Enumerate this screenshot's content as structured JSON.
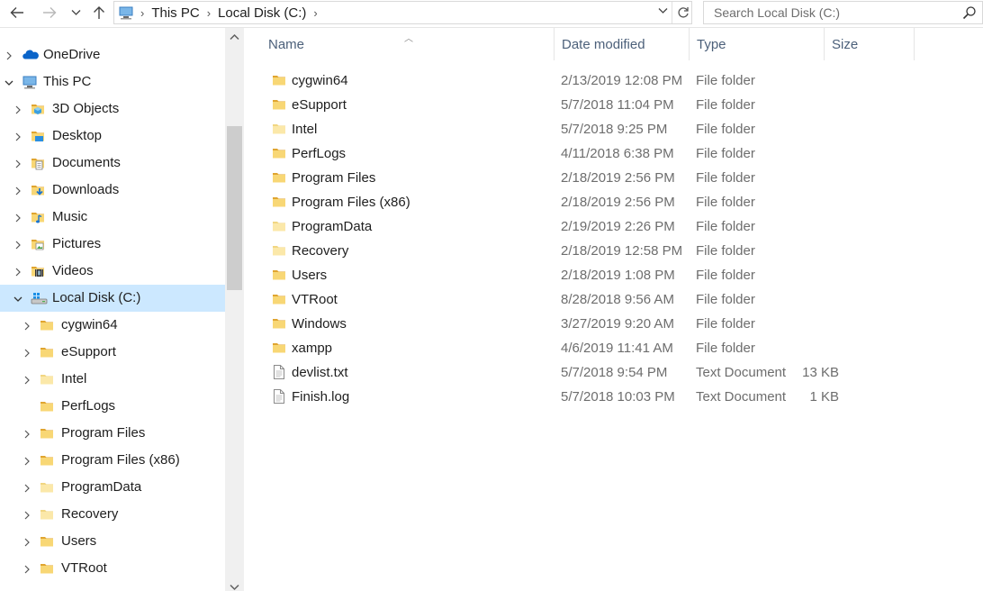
{
  "address": {
    "breadcrumbs": [
      "This PC",
      "Local Disk (C:)"
    ],
    "search_placeholder": "Search Local Disk (C:)"
  },
  "nav": {
    "items": [
      {
        "label": "OneDrive",
        "level": 0,
        "icon": "onedrive-icon",
        "expander": "collapsed",
        "selected": false
      },
      {
        "label": "This PC",
        "level": 0,
        "icon": "this-pc-icon",
        "expander": "expanded",
        "selected": false
      },
      {
        "label": "3D Objects",
        "level": 1,
        "icon": "3d-objects-icon",
        "expander": "collapsed",
        "selected": false
      },
      {
        "label": "Desktop",
        "level": 1,
        "icon": "desktop-icon",
        "expander": "collapsed",
        "selected": false
      },
      {
        "label": "Documents",
        "level": 1,
        "icon": "documents-icon",
        "expander": "collapsed",
        "selected": false
      },
      {
        "label": "Downloads",
        "level": 1,
        "icon": "downloads-icon",
        "expander": "collapsed",
        "selected": false
      },
      {
        "label": "Music",
        "level": 1,
        "icon": "music-icon",
        "expander": "collapsed",
        "selected": false
      },
      {
        "label": "Pictures",
        "level": 1,
        "icon": "pictures-icon",
        "expander": "collapsed",
        "selected": false
      },
      {
        "label": "Videos",
        "level": 1,
        "icon": "videos-icon",
        "expander": "collapsed",
        "selected": false
      },
      {
        "label": "Local Disk (C:)",
        "level": 1,
        "icon": "local-disk-icon",
        "expander": "expanded",
        "selected": true
      },
      {
        "label": "cygwin64",
        "level": 2,
        "icon": "folder-icon",
        "expander": "collapsed",
        "selected": false
      },
      {
        "label": "eSupport",
        "level": 2,
        "icon": "folder-icon",
        "expander": "collapsed",
        "selected": false
      },
      {
        "label": "Intel",
        "level": 2,
        "icon": "folder-light-icon",
        "expander": "collapsed",
        "selected": false
      },
      {
        "label": "PerfLogs",
        "level": 2,
        "icon": "folder-icon",
        "expander": "none",
        "selected": false
      },
      {
        "label": "Program Files",
        "level": 2,
        "icon": "folder-icon",
        "expander": "collapsed",
        "selected": false
      },
      {
        "label": "Program Files (x86)",
        "level": 2,
        "icon": "folder-icon",
        "expander": "collapsed",
        "selected": false
      },
      {
        "label": "ProgramData",
        "level": 2,
        "icon": "folder-light-icon",
        "expander": "collapsed",
        "selected": false
      },
      {
        "label": "Recovery",
        "level": 2,
        "icon": "folder-light-icon",
        "expander": "collapsed",
        "selected": false
      },
      {
        "label": "Users",
        "level": 2,
        "icon": "folder-icon",
        "expander": "collapsed",
        "selected": false
      },
      {
        "label": "VTRoot",
        "level": 2,
        "icon": "folder-icon",
        "expander": "collapsed",
        "selected": false
      }
    ]
  },
  "columns": {
    "name": "Name",
    "date": "Date modified",
    "type": "Type",
    "size": "Size"
  },
  "files": [
    {
      "name": "cygwin64",
      "date": "2/13/2019 12:08 PM",
      "type": "File folder",
      "size": "",
      "icon": "folder-icon"
    },
    {
      "name": "eSupport",
      "date": "5/7/2018 11:04 PM",
      "type": "File folder",
      "size": "",
      "icon": "folder-icon"
    },
    {
      "name": "Intel",
      "date": "5/7/2018 9:25 PM",
      "type": "File folder",
      "size": "",
      "icon": "folder-light-icon"
    },
    {
      "name": "PerfLogs",
      "date": "4/11/2018 6:38 PM",
      "type": "File folder",
      "size": "",
      "icon": "folder-icon"
    },
    {
      "name": "Program Files",
      "date": "2/18/2019 2:56 PM",
      "type": "File folder",
      "size": "",
      "icon": "folder-icon"
    },
    {
      "name": "Program Files (x86)",
      "date": "2/18/2019 2:56 PM",
      "type": "File folder",
      "size": "",
      "icon": "folder-icon"
    },
    {
      "name": "ProgramData",
      "date": "2/19/2019 2:26 PM",
      "type": "File folder",
      "size": "",
      "icon": "folder-light-icon"
    },
    {
      "name": "Recovery",
      "date": "2/18/2019 12:58 PM",
      "type": "File folder",
      "size": "",
      "icon": "folder-light-icon"
    },
    {
      "name": "Users",
      "date": "2/18/2019 1:08 PM",
      "type": "File folder",
      "size": "",
      "icon": "folder-icon"
    },
    {
      "name": "VTRoot",
      "date": "8/28/2018 9:56 AM",
      "type": "File folder",
      "size": "",
      "icon": "folder-icon"
    },
    {
      "name": "Windows",
      "date": "3/27/2019 9:20 AM",
      "type": "File folder",
      "size": "",
      "icon": "folder-icon"
    },
    {
      "name": "xampp",
      "date": "4/6/2019 11:41 AM",
      "type": "File folder",
      "size": "",
      "icon": "folder-icon"
    },
    {
      "name": "devlist.txt",
      "date": "5/7/2018 9:54 PM",
      "type": "Text Document",
      "size": "13 KB",
      "icon": "text-file-icon"
    },
    {
      "name": "Finish.log",
      "date": "5/7/2018 10:03 PM",
      "type": "Text Document",
      "size": "1 KB",
      "icon": "text-file-icon"
    }
  ],
  "colors": {
    "selection": "#cce8ff",
    "folder": "#f8d775",
    "folder_dark": "#e0a530",
    "header_text": "#4c607a"
  }
}
